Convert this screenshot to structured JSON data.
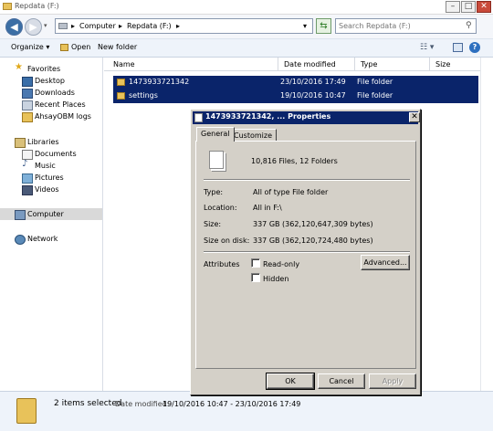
{
  "window": {
    "title": "Repdata (F:)"
  },
  "address": {
    "segments": [
      "Computer",
      "Repdata (F:)"
    ]
  },
  "search": {
    "placeholder": "Search Repdata (F:)"
  },
  "toolbar": {
    "organize": "Organize",
    "open": "Open",
    "new_folder": "New folder"
  },
  "nav": {
    "favorites": "Favorites",
    "favorite_items": [
      "Desktop",
      "Downloads",
      "Recent Places",
      "AhsayOBM logs"
    ],
    "libraries": "Libraries",
    "library_items": [
      "Documents",
      "Music",
      "Pictures",
      "Videos"
    ],
    "computer": "Computer",
    "network": "Network"
  },
  "columns": [
    "Name",
    "Date modified",
    "Type",
    "Size"
  ],
  "files": [
    {
      "name": "1473933721342",
      "modified": "23/10/2016 17:49",
      "type": "File folder"
    },
    {
      "name": "settings",
      "modified": "19/10/2016 10:47",
      "type": "File folder"
    }
  ],
  "status": {
    "selected": "2 items selected",
    "modified_label": "Date modified:",
    "modified_value": "19/10/2016 10:47 - 23/10/2016 17:49"
  },
  "dialog": {
    "title": "1473933721342, ... Properties",
    "tabs": [
      "General",
      "Customize"
    ],
    "summary": "10,816 Files, 12 Folders",
    "props": [
      {
        "label": "Type:",
        "value": "All of type File folder"
      },
      {
        "label": "Location:",
        "value": "All in F:\\"
      },
      {
        "label": "Size:",
        "value": "337 GB (362,120,647,309 bytes)"
      },
      {
        "label": "Size on disk:",
        "value": "337 GB (362,120,724,480 bytes)"
      }
    ],
    "attributes_label": "Attributes",
    "readonly": "Read-only",
    "hidden": "Hidden",
    "advanced": "Advanced...",
    "ok": "OK",
    "cancel": "Cancel",
    "apply": "Apply"
  }
}
